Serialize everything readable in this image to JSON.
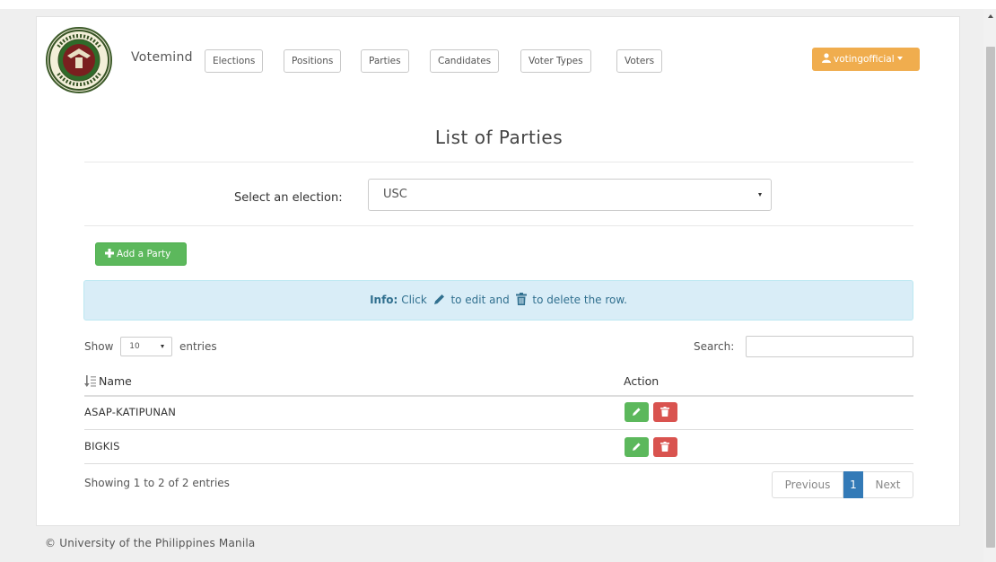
{
  "brand": "Votemind",
  "nav": [
    "Elections",
    "Positions",
    "Parties",
    "Candidates",
    "Voter Types",
    "Voters"
  ],
  "user": {
    "name": "votingofficial",
    "icon": "user-icon"
  },
  "page_title": "List of Parties",
  "election_select": {
    "label": "Select an election:",
    "value": "USC"
  },
  "add_button": {
    "label": "Add a Party",
    "icon": "plus-icon"
  },
  "info": {
    "prefix": "Info:",
    "text1": "Click",
    "text2": "to edit and",
    "text3": "to delete the row."
  },
  "table_controls": {
    "show": "Show",
    "length": "10",
    "entries": "entries",
    "search_label": "Search:"
  },
  "table": {
    "headers": [
      "Name",
      "Action"
    ],
    "rows": [
      "ASAP-KATIPUNAN",
      "BIGKIS"
    ]
  },
  "summary": "Showing 1 to 2 of 2 entries",
  "pagination": {
    "previous": "Previous",
    "current": "1",
    "next": "Next"
  },
  "footer": "© University of the Philippines Manila",
  "colors": {
    "success": "#5cb85c",
    "danger": "#d9534f",
    "warning": "#f0ad4e",
    "primary": "#337ab7",
    "info_bg": "#d9edf7"
  }
}
